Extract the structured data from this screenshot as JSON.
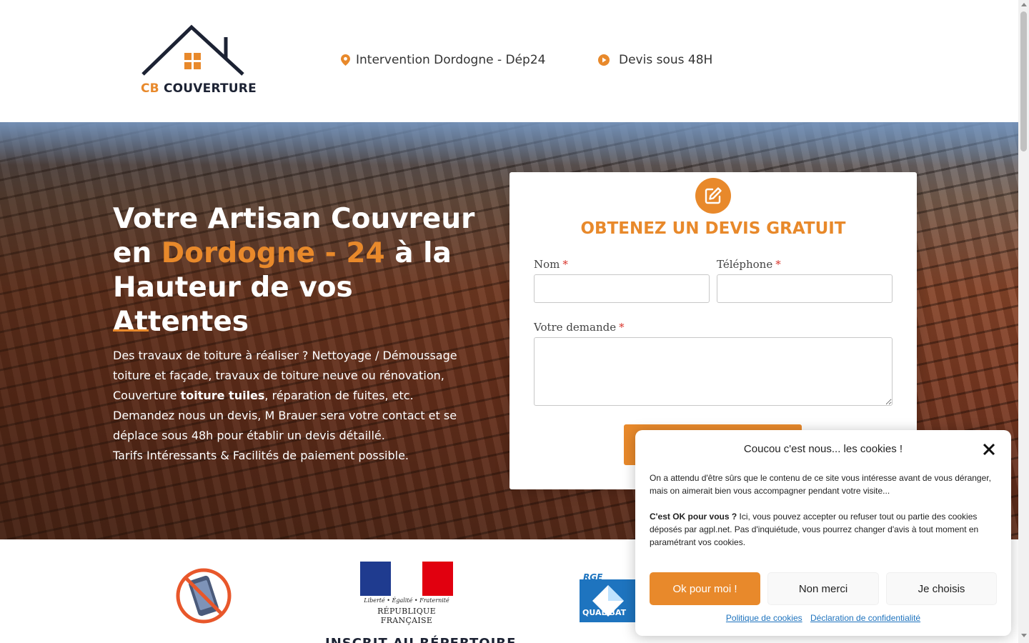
{
  "header": {
    "logo": {
      "brand_prefix": "CB",
      "brand_name": "COUVERTURE"
    },
    "location_text": "Intervention Dordogne - Dép24",
    "quote_delay_text": "Devis sous 48H"
  },
  "hero": {
    "title_part1": "Votre Artisan Couvreur en ",
    "title_highlight": "Dordogne - 24",
    "title_part2": " à la Hauteur de vos Attentes",
    "text_part1": "Des travaux de toiture à réaliser ? Nettoyage / Démoussage toiture et façade, travaux de toiture neuve ou rénovation, Couverture ",
    "text_bold": "toiture tuiles",
    "text_part2": ", réparation de fuites, etc. Demandez nous un devis, M Brauer sera votre contact et se déplace sous 48h pour établir un devis détaillé.",
    "text_line2": "Tarifs Intéressants & Facilités de paiement possible."
  },
  "form": {
    "title": "OBTENEZ UN DEVIS GRATUIT",
    "name_label": "Nom",
    "phone_label": "Téléphone",
    "request_label": "Votre demande",
    "required_marker": "*",
    "name_value": "",
    "phone_value": "",
    "request_value": ""
  },
  "badges": {
    "rf_motto": "Liberté • Égalité • Fraternité",
    "rf_name": "RÉPUBLIQUE FRANÇAISE",
    "rge_label": "RGE",
    "qualibat_label": "QUALIBAT",
    "partial_heading": "INSCRIT AU RÉPERTOIRE"
  },
  "cookie": {
    "title": "Coucou c'est nous... les cookies !",
    "paragraph1": "On a attendu d'être sûrs que le contenu de ce site vous intéresse avant de vous déranger, mais on aimerait bien vous accompagner pendant votre visite...",
    "paragraph2_bold": "C'est OK pour vous ?",
    "paragraph2": "  Ici, vous pouvez accepter ou refuser tout ou partie des cookies déposés par agpl.net. Pas d'inquiétude, vous pourrez changer d'avis à tout moment en paramétrant vos cookies.",
    "accept_label": "Ok pour moi !",
    "deny_label": "Non merci",
    "choose_label": "Je choisis",
    "policy_link": "Politique de cookies",
    "privacy_link": "Déclaration de confidentialité"
  },
  "colors": {
    "accent": "#e8892b",
    "dark": "#1c2233",
    "link": "#1e73be"
  },
  "icons": [
    "house-roof-icon",
    "map-pin-icon",
    "play-circle-icon",
    "edit-icon",
    "close-icon",
    "no-phone-icon",
    "qualibat-logo"
  ]
}
